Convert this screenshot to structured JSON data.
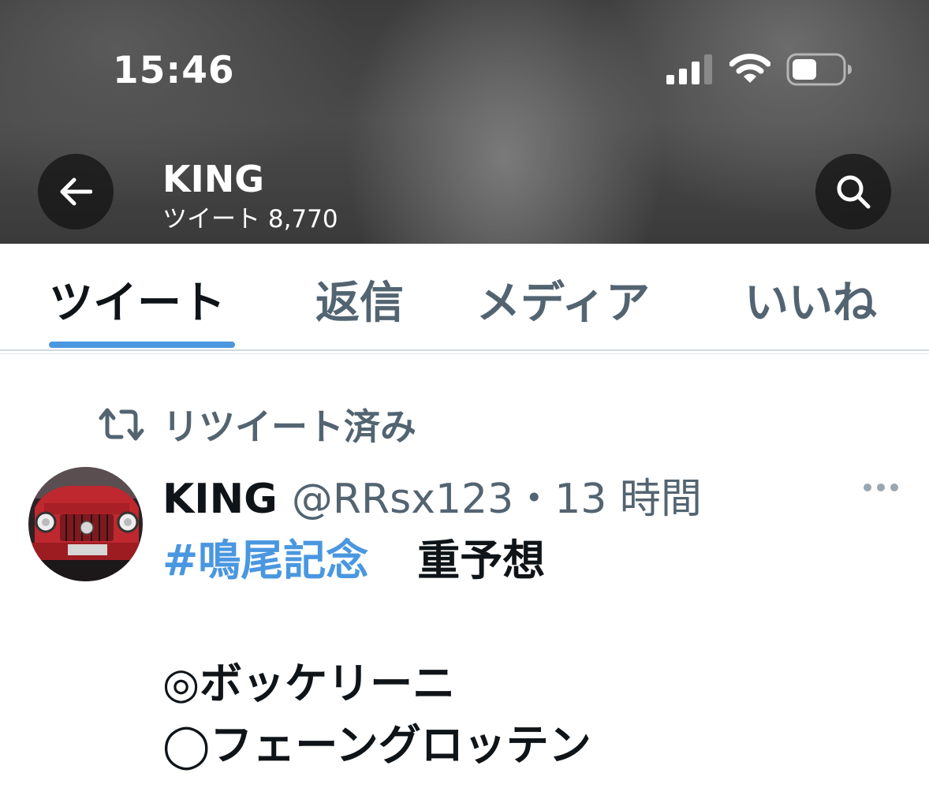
{
  "status_bar": {
    "time": "15:46"
  },
  "header": {
    "name": "KING",
    "tweet_count": "ツイート 8,770",
    "back_icon": "arrow-left-icon",
    "search_icon": "search-icon"
  },
  "tabs": [
    {
      "label": "ツイート",
      "active": true
    },
    {
      "label": "返信",
      "active": false
    },
    {
      "label": "メディア",
      "active": false
    },
    {
      "label": "いいね",
      "active": false
    }
  ],
  "tweet": {
    "retweet_label": "リツイート済み",
    "author_name": "KING",
    "author_meta": "@RRsx123・13 時間",
    "hashtag": "#鳴尾記念",
    "text_line1": "重予想",
    "lines": [
      "◎ボッケリーニ",
      "◯フェーングロッテン"
    ]
  },
  "colors": {
    "accent": "#4a97e0",
    "text_primary": "#0f1419",
    "text_secondary": "#536471"
  }
}
